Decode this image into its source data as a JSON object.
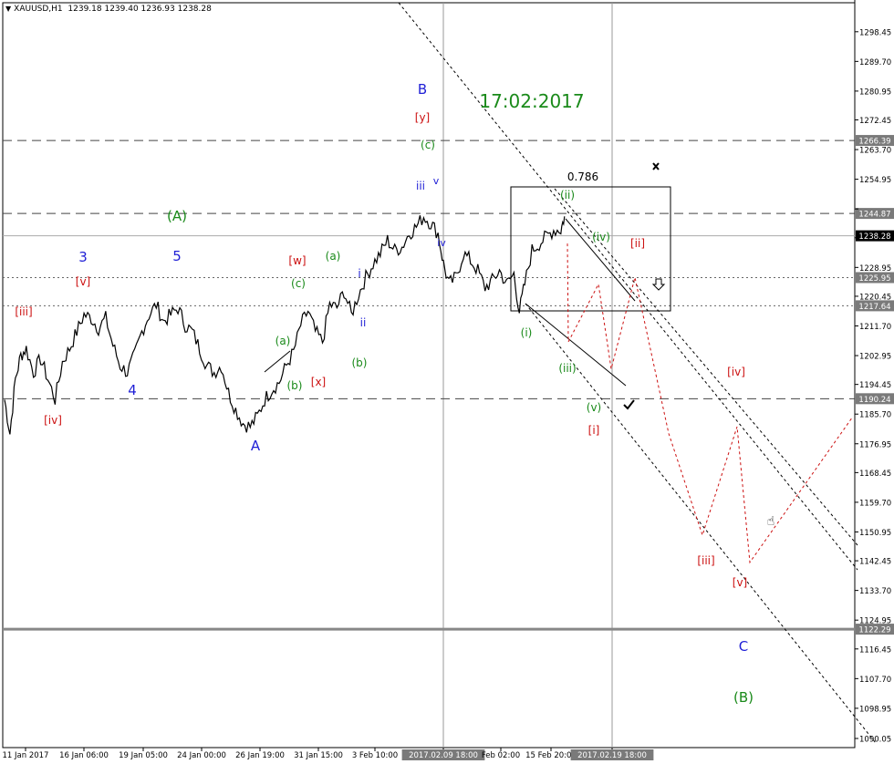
{
  "header": {
    "symbol": "XAUUSD,H1",
    "ohlc": "1239.18 1239.40 1236.93 1238.28"
  },
  "colors": {
    "blue": "#1f1fd6",
    "green": "#1a8a1a",
    "red": "#cc1111",
    "black": "#000000",
    "axis_highlight": "#7a7a7a"
  },
  "chart_data": {
    "type": "line",
    "title": "XAUUSD,H1",
    "ylim": [
      1090.05,
      1303.0
    ],
    "y_ticks": [
      1298.45,
      1289.7,
      1280.95,
      1272.45,
      1263.7,
      1254.95,
      1246.2,
      1237.7,
      1228.95,
      1220.45,
      1211.7,
      1202.95,
      1194.45,
      1185.7,
      1176.95,
      1168.45,
      1159.7,
      1150.95,
      1142.45,
      1133.7,
      1124.95,
      1116.45,
      1107.7,
      1098.95,
      1090.05
    ],
    "x_ticks": [
      "11 Jan 2017",
      "16 Jan 06:00",
      "19 Jan 05:00",
      "24 Jan 00:00",
      "26 Jan 19:00",
      "31 Jan 15:00",
      "3 Feb 10:00",
      "2017.02.09 18:00",
      "Feb 02:00",
      "15 Feb 20:00",
      "2017.02.19 18:00"
    ],
    "x_tick_highlight": [
      "2017.02.09 18:00",
      "2017.02.19 18:00"
    ],
    "price_series": {
      "name": "XAUUSD H1",
      "x": [
        0,
        6,
        12,
        18,
        24,
        32,
        40,
        48,
        56,
        64,
        72,
        80,
        88,
        96,
        104,
        112,
        120,
        128,
        136,
        144,
        152,
        160,
        168,
        176,
        184,
        192,
        200,
        208,
        216,
        224,
        232,
        240,
        248,
        256,
        264,
        272,
        280,
        288,
        296,
        304,
        312,
        320,
        328,
        336,
        344,
        352,
        360,
        368,
        376,
        384,
        392,
        400,
        408,
        416,
        424,
        432,
        440,
        448,
        456,
        464,
        472,
        480,
        486,
        492,
        500,
        508,
        516,
        524,
        532,
        540,
        548,
        556,
        564,
        570,
        576,
        584,
        592,
        600,
        608,
        616,
        620
      ],
      "y": [
        1190,
        1180,
        1196,
        1203,
        1205,
        1198,
        1202,
        1196,
        1190,
        1201,
        1205,
        1210,
        1215,
        1214,
        1211,
        1214,
        1206,
        1200,
        1198,
        1203,
        1210,
        1215,
        1218,
        1213,
        1215,
        1217,
        1212,
        1210,
        1205,
        1200,
        1198,
        1200,
        1192,
        1187,
        1183,
        1182,
        1185,
        1190,
        1193,
        1195,
        1200,
        1204,
        1212,
        1216,
        1210,
        1207,
        1218,
        1217,
        1222,
        1215,
        1221,
        1226,
        1230,
        1233,
        1237,
        1234,
        1235,
        1239,
        1241,
        1244,
        1242,
        1239,
        1230,
        1224,
        1226,
        1233,
        1231,
        1228,
        1223,
        1225,
        1228,
        1224,
        1227,
        1216,
        1224,
        1234,
        1236,
        1238,
        1240,
        1240,
        1244
      ]
    },
    "hlines": [
      {
        "label": "1266.39",
        "value": 1266.39,
        "style": "dash"
      },
      {
        "label": "1244.87",
        "value": 1244.87,
        "style": "dash"
      },
      {
        "label": "1238.28",
        "value": 1238.28,
        "style": "solid",
        "current": true
      },
      {
        "label": "1225.95",
        "value": 1225.95,
        "style": "dot"
      },
      {
        "label": "1217.64",
        "value": 1217.64,
        "style": "dot"
      },
      {
        "label": "1190.24",
        "value": 1190.24,
        "style": "dash"
      },
      {
        "label": "1122.29",
        "value": 1122.29,
        "style": "solid-thick"
      }
    ],
    "projection": {
      "y": [
        1236,
        1207,
        1224,
        1199,
        1226,
        1180,
        1150,
        1182,
        1142,
        1185
      ]
    },
    "annotations": [
      {
        "text": "17:02:2017",
        "color": "green",
        "size": "big"
      },
      {
        "text": "0.786",
        "color": "black"
      },
      {
        "text": "B",
        "color": "blue"
      },
      {
        "text": "[y]",
        "color": "red"
      },
      {
        "text": "(c)",
        "color": "green"
      },
      {
        "text": "(A)",
        "color": "green"
      },
      {
        "text": "3",
        "color": "blue"
      },
      {
        "text": "5",
        "color": "blue"
      },
      {
        "text": "4",
        "color": "blue"
      },
      {
        "text": "A",
        "color": "blue"
      },
      {
        "text": "[v]",
        "color": "red"
      },
      {
        "text": "[iii]",
        "color": "red"
      },
      {
        "text": "[iv]",
        "color": "red"
      },
      {
        "text": "[w]",
        "color": "red"
      },
      {
        "text": "[x]",
        "color": "red"
      },
      {
        "text": "(a)",
        "color": "green"
      },
      {
        "text": "(c)",
        "color": "green"
      },
      {
        "text": "(a)",
        "color": "green"
      },
      {
        "text": "(b)",
        "color": "green"
      },
      {
        "text": "(b)",
        "color": "green"
      },
      {
        "text": "i",
        "color": "blue"
      },
      {
        "text": "ii",
        "color": "blue"
      },
      {
        "text": "iii",
        "color": "blue"
      },
      {
        "text": "v",
        "color": "blue"
      },
      {
        "text": "iv",
        "color": "blue"
      },
      {
        "text": "(ii)",
        "color": "green"
      },
      {
        "text": "(iv)",
        "color": "green"
      },
      {
        "text": "(i)",
        "color": "green"
      },
      {
        "text": "(iii)",
        "color": "green"
      },
      {
        "text": "(v)",
        "color": "green"
      },
      {
        "text": "[i]",
        "color": "red"
      },
      {
        "text": "[ii]",
        "color": "red"
      },
      {
        "text": "[iii]",
        "color": "red"
      },
      {
        "text": "[iv]",
        "color": "red"
      },
      {
        "text": "[v]",
        "color": "red"
      },
      {
        "text": "C",
        "color": "blue"
      },
      {
        "text": "(B)",
        "color": "green"
      }
    ],
    "icons": [
      "close-x-icon",
      "arrow-down-icon",
      "checkmark-icon",
      "hand-pointer-icon"
    ],
    "grid": false
  }
}
